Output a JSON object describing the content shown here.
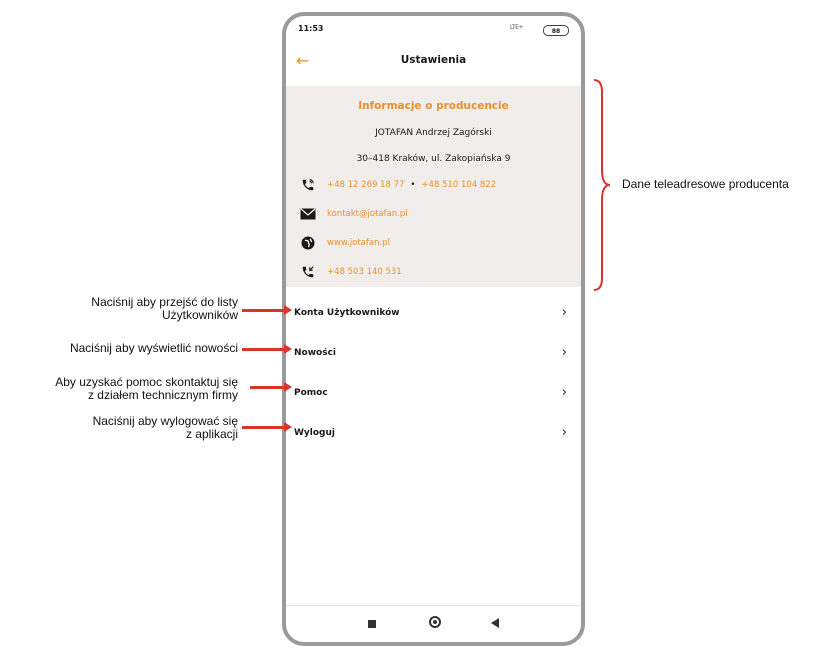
{
  "status": {
    "time": "11:53",
    "network": "LTE+",
    "battery": "88"
  },
  "appbar": {
    "title": "Ustawienia",
    "back_icon": "arrow-left-icon"
  },
  "info": {
    "title": "Informacje o producencie",
    "company": "JOTAFAN Andrzej Zagórski",
    "address": "30–418 Kraków, ul. Zakopiańska 9",
    "phone1": "+48 12 269 18 77",
    "separator": "•",
    "phone2": "+48 510 104 822",
    "email": "kontakt@jotafan.pl",
    "website": "www.jotafan.pl",
    "mobile": "+48 503 140 531"
  },
  "menu": [
    {
      "label": "Konta Użytkowników"
    },
    {
      "label": "Nowości"
    },
    {
      "label": "Pomoc"
    },
    {
      "label": "Wyloguj"
    }
  ],
  "annotations": {
    "users_line1": "Naciśnij aby przejść do listy",
    "users_line2": "Użytkowników",
    "news": "Naciśnij aby wyświetlić nowości",
    "help_line1": "Aby uzyskać pomoc skontaktuj się",
    "help_line2": "z działem technicznym firmy",
    "logout_line1": "Naciśnij aby wylogować się",
    "logout_line2": "z aplikacji",
    "contact_data": "Dane teleadresowe producenta"
  },
  "colors": {
    "accent": "#e8912c",
    "arrow": "#d9352b",
    "panel": "#f0edea"
  }
}
